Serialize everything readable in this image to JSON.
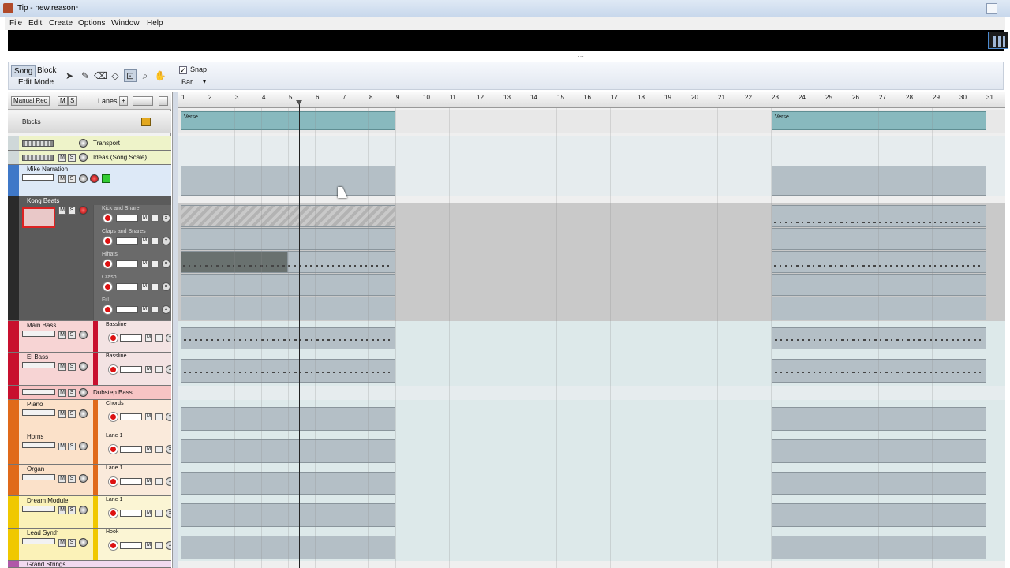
{
  "window": {
    "title": "Tip - new.reason*"
  },
  "menu": [
    "File",
    "Edit",
    "Create",
    "Options",
    "Window",
    "Help"
  ],
  "toolbar": {
    "song_label": "Song",
    "block_label": "Block",
    "edit_mode_label": "Edit Mode",
    "snap_label": "Snap",
    "snap_checked": "✓",
    "snap_value": "Bar",
    "tools": [
      "selection-arrow-icon",
      "pencil-icon",
      "eraser-icon",
      "razor-icon",
      "mute-tool-icon",
      "magnify-icon",
      "hand-icon"
    ]
  },
  "left_header": {
    "manual_rec_label": "Manual Rec",
    "m_label": "M",
    "s_label": "S",
    "lanes_label": "Lanes",
    "add_label": "+",
    "blocks_label": "Blocks"
  },
  "tracks": [
    {
      "name": "Transport"
    },
    {
      "name": "Ideas (Song Scale)"
    },
    {
      "name": "Mike Narration"
    },
    {
      "name": "Kong Beats",
      "lanes": [
        "Kick and Snare",
        "Claps and Snares",
        "Hihats",
        "Crash",
        "Fill"
      ]
    },
    {
      "name": "Main Bass",
      "lane": "Bassline"
    },
    {
      "name": "El Bass",
      "lane": "Bassline"
    },
    {
      "name": "Dubstep Bass"
    },
    {
      "name": "Piano",
      "lane": "Chords"
    },
    {
      "name": "Horns",
      "lane": "Lane 1"
    },
    {
      "name": "Organ",
      "lane": "Lane 1"
    },
    {
      "name": "Dream Module",
      "lane": "Lane 1"
    },
    {
      "name": "Lead Synth",
      "lane": "Hook"
    },
    {
      "name": "Grand Strings"
    }
  ],
  "ruler": {
    "bars": [
      "1",
      "2",
      "3",
      "4",
      "5",
      "6",
      "7",
      "8",
      "9",
      "10",
      "11",
      "12",
      "13",
      "14",
      "15",
      "16",
      "17",
      "18",
      "19",
      "20",
      "21",
      "22",
      "23",
      "24",
      "25",
      "26",
      "27",
      "28",
      "29",
      "30",
      "31"
    ]
  },
  "blocks": [
    {
      "label": "Verse"
    },
    {
      "label": "Verse"
    }
  ],
  "colors": {
    "accent": "#7fa7d8",
    "clip": "#b4bfc6",
    "block": "#88b9be",
    "bass": "#c8102e",
    "keys": "#e06a1a",
    "synth": "#f0c800"
  }
}
